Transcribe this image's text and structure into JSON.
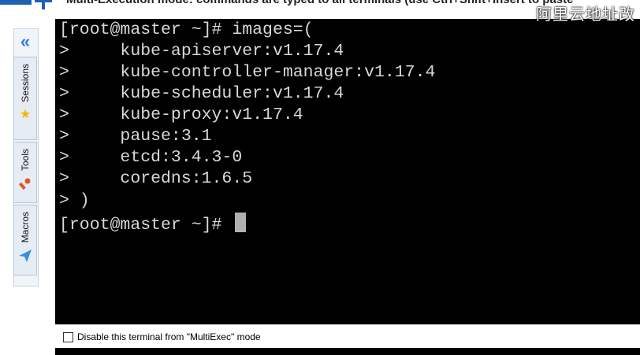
{
  "banner": {
    "text": "Multi-Execution mode: commands are typed to all terminals (use Ctrl+Shift+Insert to paste",
    "watermark": "阿里云地址改"
  },
  "sidebar": {
    "tabs": [
      {
        "label": "Sessions",
        "icon": "star-icon"
      },
      {
        "label": "Tools",
        "icon": "wrench-icon"
      },
      {
        "label": "Macros",
        "icon": "paper-plane-icon"
      }
    ]
  },
  "terminal": {
    "lines": [
      "[root@master ~]# images=(",
      ">     kube-apiserver:v1.17.4",
      ">     kube-controller-manager:v1.17.4",
      ">     kube-scheduler:v1.17.4",
      ">     kube-proxy:v1.17.4",
      ">     pause:3.1",
      ">     etcd:3.4.3-0",
      ">     coredns:1.6.5",
      "> )",
      "[root@master ~]# "
    ]
  },
  "multiexec": {
    "checkbox_label": "Disable this terminal from \"MultiExec\" mode",
    "checked": false
  },
  "colors": {
    "terminal_bg": "#000000",
    "terminal_fg": "#d8d8d8",
    "accent": "#2a7de1"
  }
}
